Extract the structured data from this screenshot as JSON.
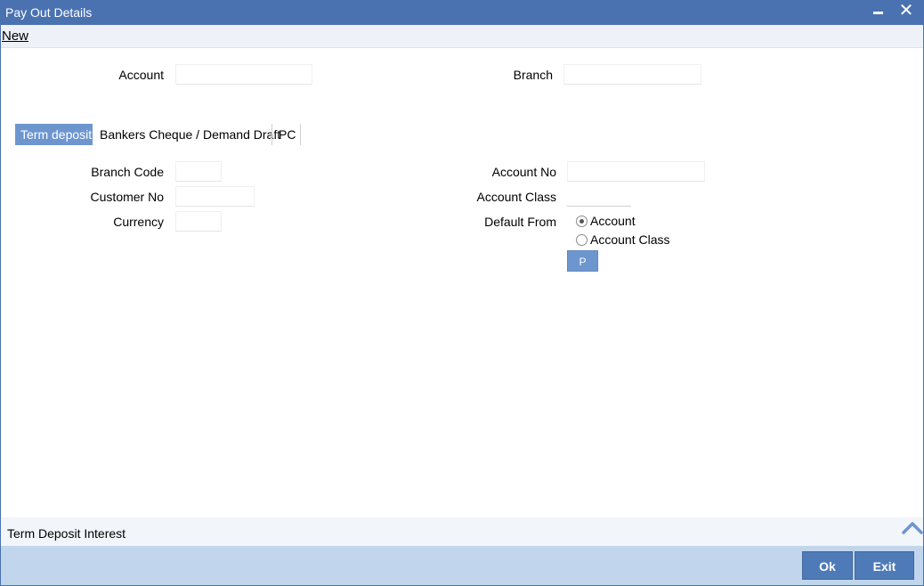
{
  "window": {
    "title": "Pay Out Details",
    "close_glyph": "✕"
  },
  "toolbar": {
    "new_label": "New"
  },
  "header_fields": {
    "account_label": "Account",
    "account_value": "",
    "branch_label": "Branch",
    "branch_value": ""
  },
  "tabs": [
    {
      "label": "Term deposit",
      "active": true
    },
    {
      "label": "Bankers Cheque / Demand Draft",
      "active": false
    },
    {
      "label": "PC",
      "active": false
    }
  ],
  "form": {
    "branch_code_label": "Branch Code",
    "branch_code_value": "",
    "customer_no_label": "Customer No",
    "customer_no_value": "",
    "currency_label": "Currency",
    "currency_value": "",
    "account_no_label": "Account No",
    "account_no_value": "",
    "account_class_label": "Account Class",
    "account_class_value": "",
    "default_from_label": "Default From",
    "default_from_options": [
      {
        "label": "Account",
        "selected": true
      },
      {
        "label": "Account Class",
        "selected": false
      }
    ],
    "p_button_label": "P"
  },
  "section": {
    "label": "Term Deposit Interest",
    "toggle_icon": "chevron-up-icon"
  },
  "footer": {
    "ok_label": "Ok",
    "exit_label": "Exit"
  },
  "colors": {
    "titlebar": "#4a72b0",
    "active_tab": "#6d96cf",
    "footer": "#c1d6ec",
    "button": "#4e7bb8"
  }
}
